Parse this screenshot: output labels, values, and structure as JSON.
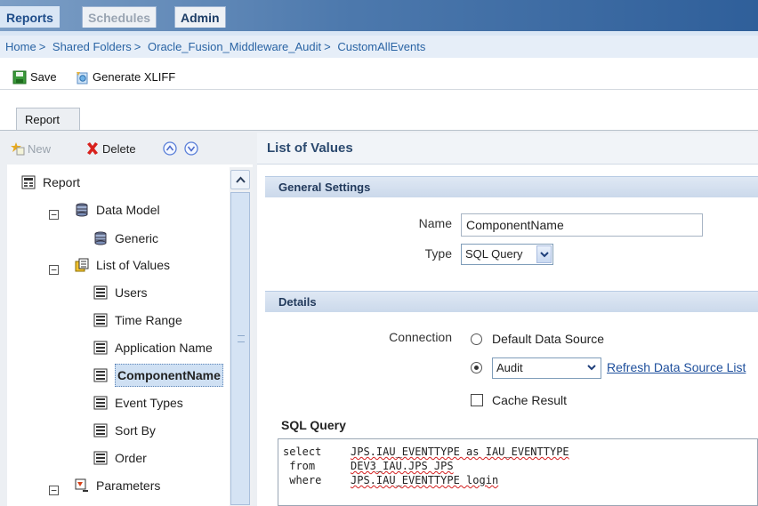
{
  "top_tabs": {
    "reports": "Reports",
    "schedules": "Schedules",
    "admin": "Admin"
  },
  "breadcrumb": {
    "items": [
      "Home",
      "Shared Folders",
      "Oracle_Fusion_Middleware_Audit",
      "CustomAllEvents"
    ],
    "sep": ">"
  },
  "toolbar": {
    "save": "Save",
    "generate_xliff": "Generate XLIFF"
  },
  "report_tab": "Report",
  "left_toolbar": {
    "new": "New",
    "delete": "Delete"
  },
  "tree": {
    "report": "Report",
    "data_model": "Data Model",
    "generic": "Generic",
    "list_of_values": "List of Values",
    "users": "Users",
    "time_range": "Time Range",
    "application_name": "Application Name",
    "component_name": "ComponentName",
    "event_types": "Event Types",
    "sort_by": "Sort By",
    "order": "Order",
    "parameters": "Parameters",
    "expander_minus": "⊟"
  },
  "main": {
    "title": "List of Values",
    "general_settings": "General Settings",
    "name_label": "Name",
    "name_value": "ComponentName",
    "type_label": "Type",
    "type_value": "SQL Query",
    "details": "Details",
    "connection_label": "Connection",
    "default_ds": "Default Data Source",
    "audit_value": "Audit",
    "refresh_link": "Refresh Data Source List",
    "cache_result": "Cache Result",
    "sql_title": "SQL Query",
    "sql_lines": [
      {
        "kw": "select",
        "code": "JPS.IAU_EVENTTYPE as IAU_EVENTTYPE"
      },
      {
        "kw": " from",
        "code": "DEV3_IAU.JPS JPS"
      },
      {
        "kw": " where",
        "code": "JPS.IAU_EVENTTYPE login"
      }
    ]
  },
  "colors": {
    "topbar": "#2f5f9a",
    "link": "#2a64a4",
    "selection": "#cfe0f3"
  }
}
